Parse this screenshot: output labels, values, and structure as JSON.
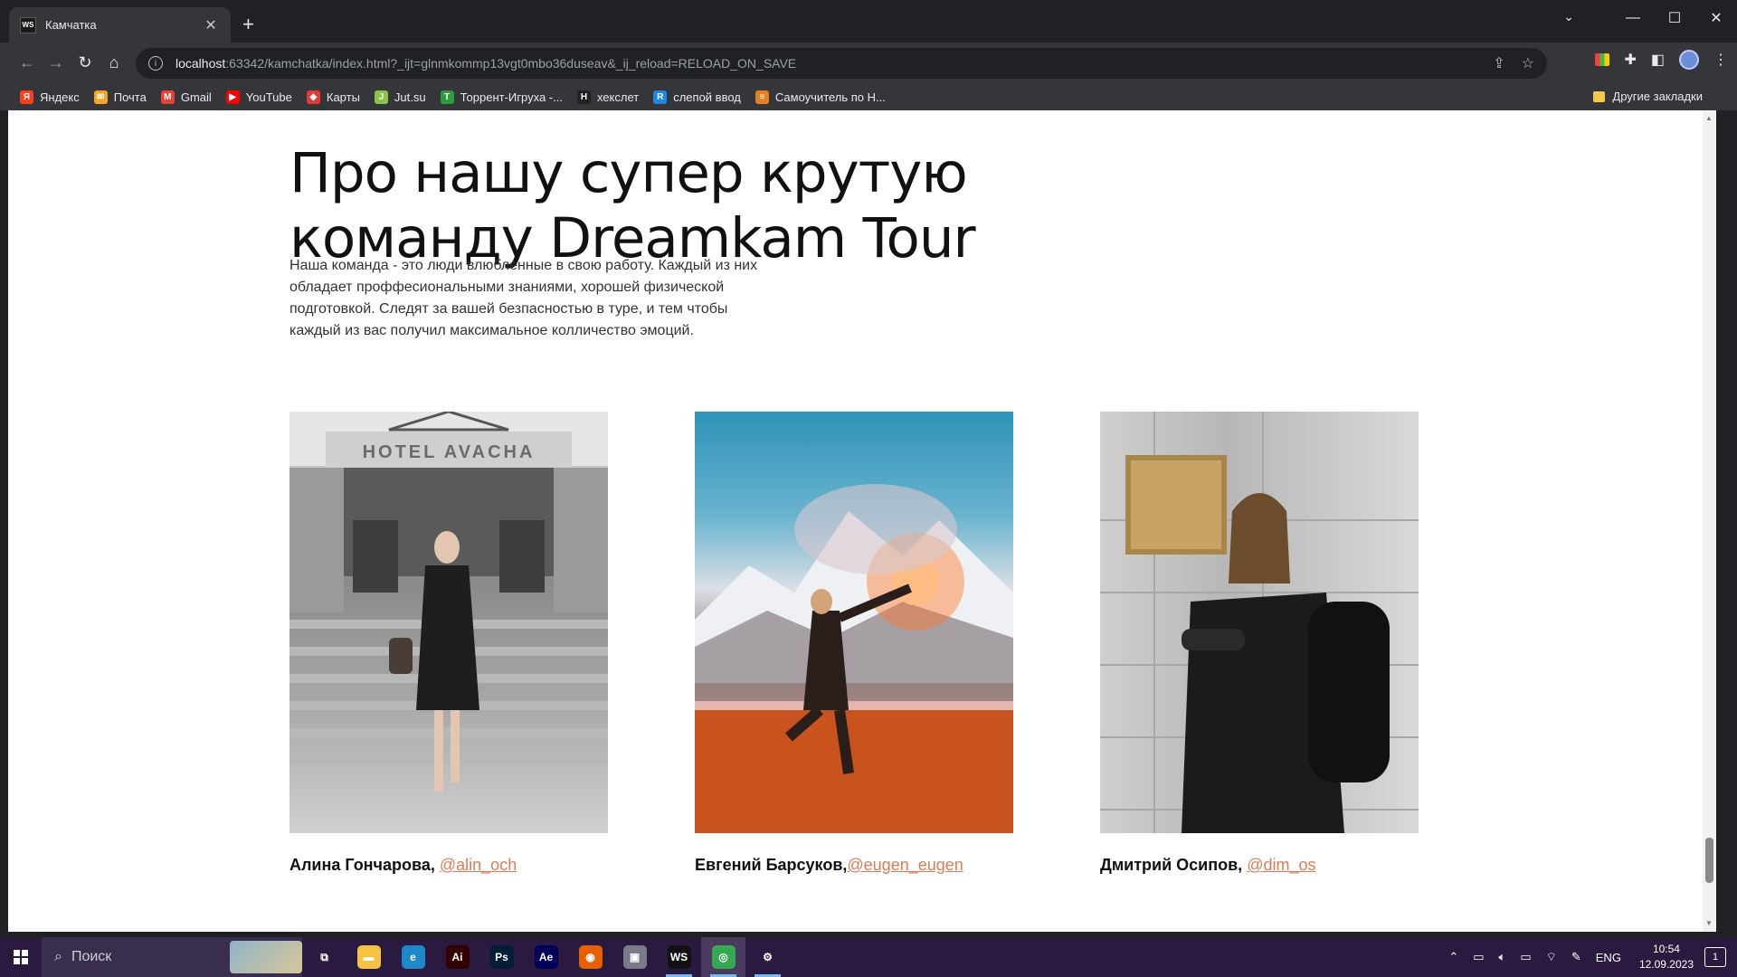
{
  "browser": {
    "tab_title": "Камчатка",
    "tab_favicon": "WS",
    "url_host": "localhost",
    "url_rest": ":63342/kamchatka/index.html?_ijt=glnmkommp13vgt0mbo36duseav&_ij_reload=RELOAD_ON_SAVE",
    "bookmarks": [
      {
        "label": "Яндекс",
        "icon": "yandex-icon",
        "color": "#fc3f1d",
        "glyph": "Я"
      },
      {
        "label": "Почта",
        "icon": "mail-icon",
        "color": "#f5a623",
        "glyph": "✉"
      },
      {
        "label": "Gmail",
        "icon": "gmail-icon",
        "color": "#ea4335",
        "glyph": "M"
      },
      {
        "label": "YouTube",
        "icon": "youtube-icon",
        "color": "#ff0000",
        "glyph": "▶"
      },
      {
        "label": "Карты",
        "icon": "maps-icon",
        "color": "#e53935",
        "glyph": "◆"
      },
      {
        "label": "Jut.su",
        "icon": "jutsu-icon",
        "color": "#8bc34a",
        "glyph": "J"
      },
      {
        "label": "Торрент-Игруха -...",
        "icon": "torrent-icon",
        "color": "#2e9b3e",
        "glyph": "T"
      },
      {
        "label": "хекслет",
        "icon": "hexlet-icon",
        "color": "#222222",
        "glyph": "H"
      },
      {
        "label": "слепой ввод",
        "icon": "typing-icon",
        "color": "#1e88e5",
        "glyph": "R"
      },
      {
        "label": "Самоучитель по Н...",
        "icon": "tutorial-icon",
        "color": "#e67e22",
        "glyph": "≡"
      }
    ],
    "other_bookmarks": "Другие закладки"
  },
  "page": {
    "heading_line1": "Про нашу супер крутую",
    "heading_line2": "команду Dreamkam Tour",
    "intro": "Наша команда - это люди влюбленные в свою работу. Каждый из них обладает проффесиональными знаниями, хорошей физической подготовкой. Следят за вашей безпасностью в туре, и тем чтобы каждый из вас получил максимальное колличество эмоций.",
    "photo1_sign": "HOTEL AVACHA",
    "team": [
      {
        "name": "Алина Гончарова,",
        "handle": "@alin_och"
      },
      {
        "name": "Евгений Барсуков,",
        "handle": "@eugen_eugen"
      },
      {
        "name": "Дмитрий Осипов,",
        "handle": "@dim_os"
      }
    ]
  },
  "taskbar": {
    "search_placeholder": "Поиск",
    "apps": [
      {
        "name": "task-view-icon",
        "glyph": "⧉",
        "color": "transparent"
      },
      {
        "name": "file-explorer-icon",
        "glyph": "▬",
        "color": "#f5c242"
      },
      {
        "name": "edge-icon",
        "glyph": "e",
        "color": "#1e88c8"
      },
      {
        "name": "illustrator-icon",
        "glyph": "Ai",
        "color": "#330000"
      },
      {
        "name": "photoshop-icon",
        "glyph": "Ps",
        "color": "#001e36"
      },
      {
        "name": "after-effects-icon",
        "glyph": "Ae",
        "color": "#00005b"
      },
      {
        "name": "firefox-icon",
        "glyph": "◉",
        "color": "#e66000"
      },
      {
        "name": "vm-icon",
        "glyph": "▣",
        "color": "#7a7a8a"
      },
      {
        "name": "webstorm-icon",
        "glyph": "WS",
        "color": "#111111"
      },
      {
        "name": "chrome-icon",
        "glyph": "◎",
        "color": "#34a853"
      },
      {
        "name": "settings-icon",
        "glyph": "⚙",
        "color": "transparent"
      }
    ],
    "language": "ENG",
    "time": "10:54",
    "date": "12.09.2023",
    "notifications": "1"
  }
}
